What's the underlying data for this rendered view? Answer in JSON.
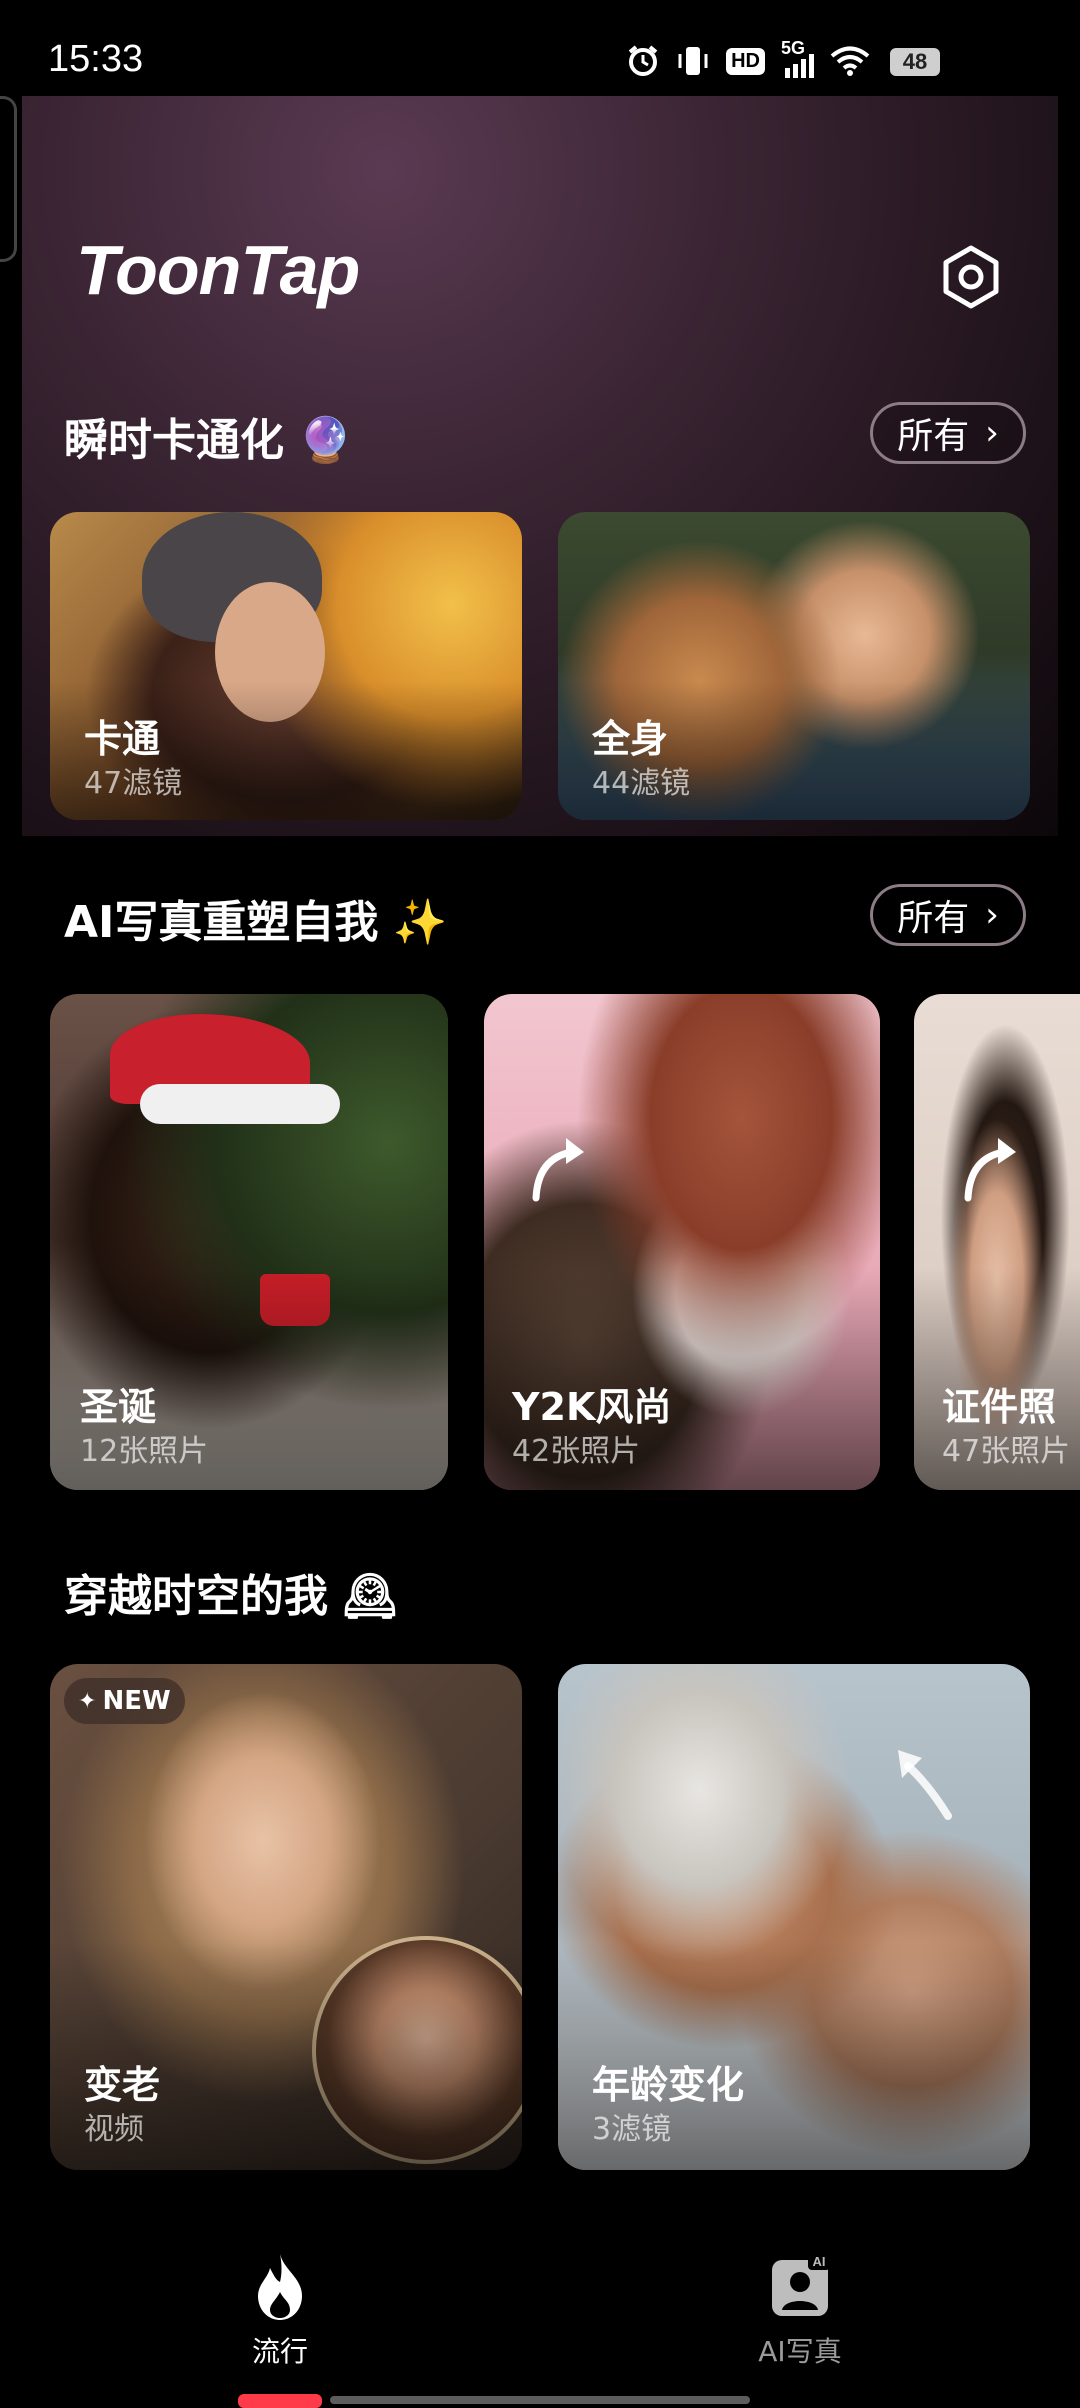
{
  "status_bar": {
    "time": "15:33",
    "network": "5G",
    "hd": "HD",
    "battery": "48"
  },
  "header": {
    "brand": "ToonTap"
  },
  "sections": {
    "instant_cartoon": {
      "title": "瞬时卡通化",
      "emoji": "🔮",
      "all_label": "所有",
      "cards": [
        {
          "title": "卡通",
          "subtitle": "47滤镜"
        },
        {
          "title": "全身",
          "subtitle": "44滤镜"
        }
      ]
    },
    "ai_portrait": {
      "title": "AI写真重塑自我",
      "emoji": "✨",
      "all_label": "所有",
      "cards": [
        {
          "title": "圣诞",
          "subtitle": "12张照片"
        },
        {
          "title": "Y2K风尚",
          "subtitle": "42张照片"
        },
        {
          "title": "证件照",
          "subtitle": "47张照片"
        }
      ]
    },
    "time_travel": {
      "title": "穿越时空的我",
      "emoji": "🕰",
      "cards": [
        {
          "badge": "NEW",
          "title": "变老",
          "subtitle": "视频"
        },
        {
          "title": "年龄变化",
          "subtitle": "3滤镜"
        }
      ]
    }
  },
  "bottom_nav": {
    "items": [
      {
        "label": "流行",
        "icon": "flame-icon",
        "active": true
      },
      {
        "label": "AI写真",
        "icon": "ai-portrait-icon",
        "active": false
      }
    ]
  },
  "colors": {
    "accent": "#ff3b4a",
    "background": "#000000"
  }
}
